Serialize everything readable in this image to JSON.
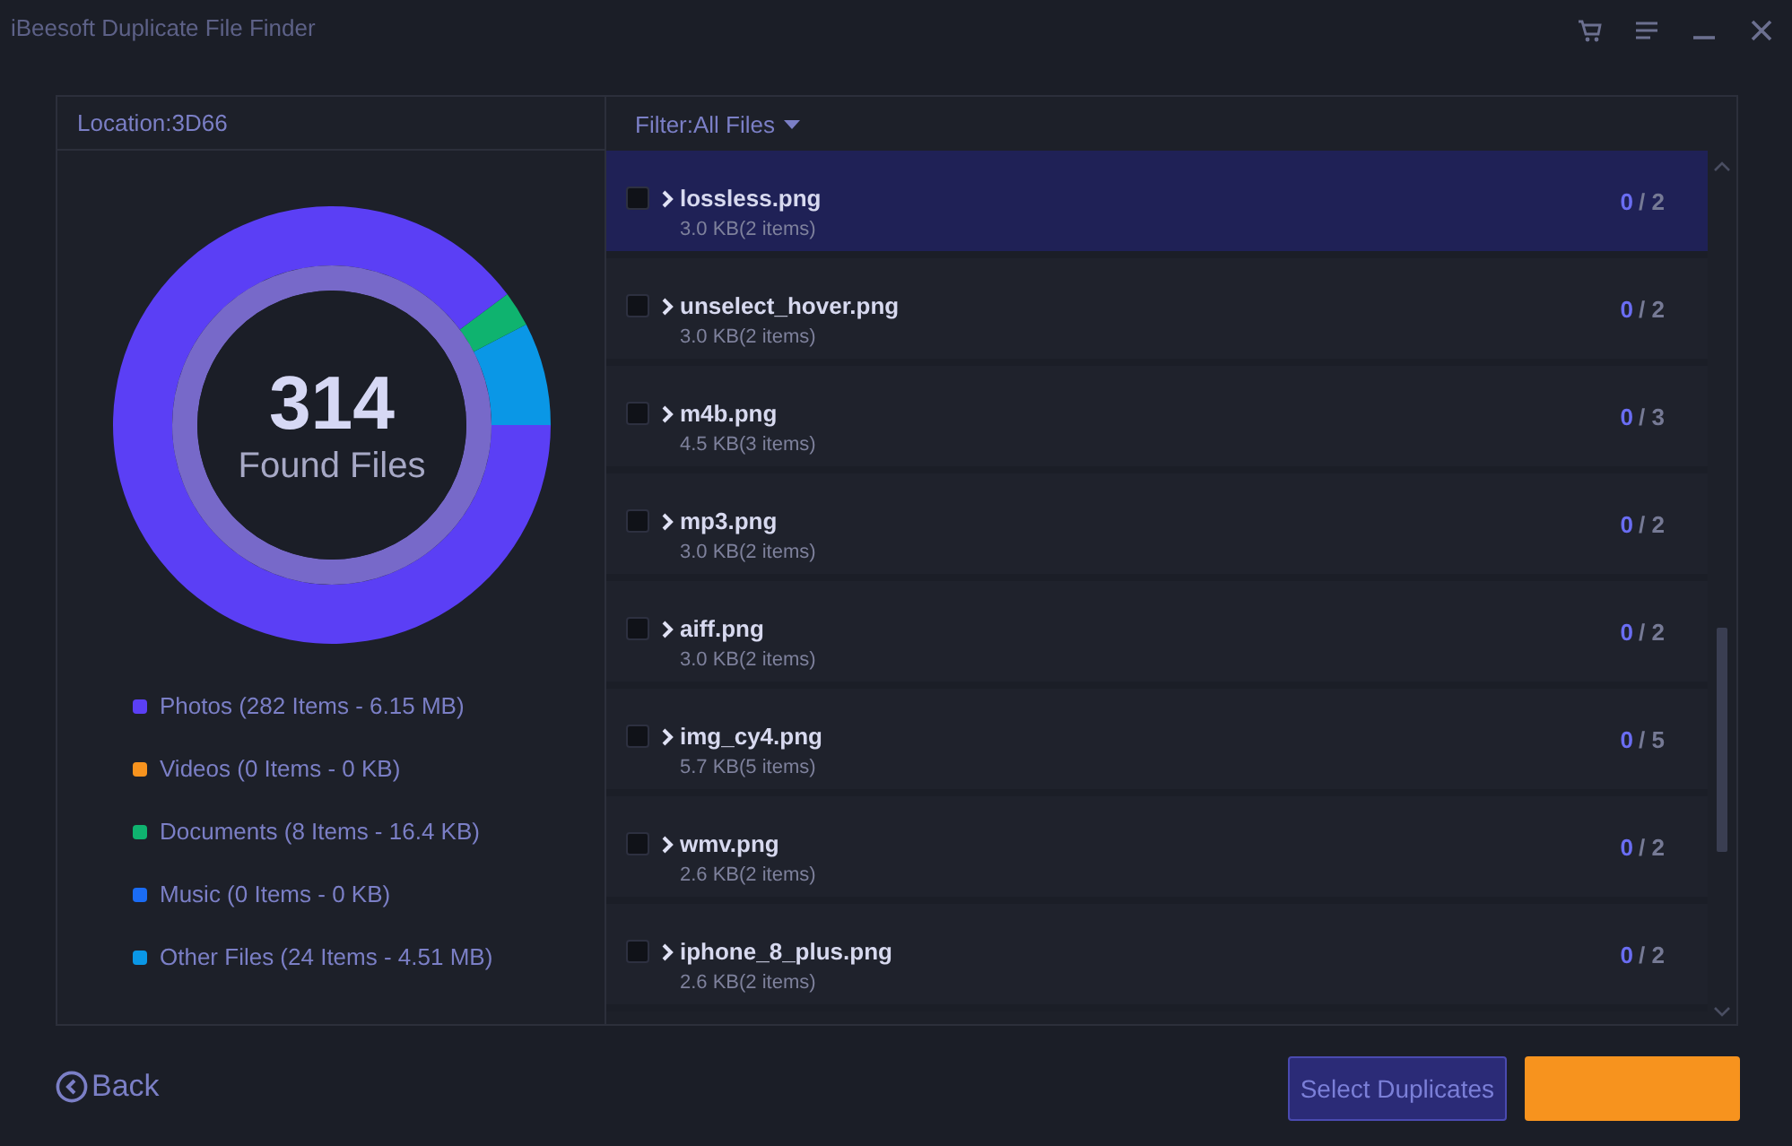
{
  "window": {
    "title": "iBeesoft Duplicate File Finder"
  },
  "location": {
    "label": "Location:3D66"
  },
  "summary": {
    "count": "314",
    "label": "Found Files",
    "chart_data": {
      "type": "donut",
      "values": [
        89.8,
        0,
        2.6,
        0,
        7.6
      ]
    }
  },
  "legend": [
    {
      "text": "Photos (282 Items - 6.15 MB)",
      "color": "#5b3ff5"
    },
    {
      "text": "Videos (0 Items - 0 KB)",
      "color": "#f7931e"
    },
    {
      "text": "Documents (8 Items - 16.4 KB)",
      "color": "#0fb36f"
    },
    {
      "text": "Music (0 Items - 0 KB)",
      "color": "#1a6cf5"
    },
    {
      "text": "Other Files (24 Items - 4.51 MB)",
      "color": "#0a97e6"
    }
  ],
  "filter": {
    "label": "Filter:All Files"
  },
  "files": [
    {
      "name": "lossless.png",
      "size": "3.0 KB(2 items)",
      "picked": "0",
      "of": "/ 2",
      "selected": true,
      "checked": false,
      "expanded": false
    },
    {
      "name": "unselect_hover.png",
      "size": "3.0 KB(2 items)",
      "picked": "0",
      "of": "/ 2",
      "selected": false,
      "checked": false,
      "expanded": false
    },
    {
      "name": "m4b.png",
      "size": "4.5 KB(3 items)",
      "picked": "0",
      "of": "/ 3",
      "selected": false,
      "checked": false,
      "expanded": false
    },
    {
      "name": "mp3.png",
      "size": "3.0 KB(2 items)",
      "picked": "0",
      "of": "/ 2",
      "selected": false,
      "checked": false,
      "expanded": false
    },
    {
      "name": "aiff.png",
      "size": "3.0 KB(2 items)",
      "picked": "0",
      "of": "/ 2",
      "selected": false,
      "checked": false,
      "expanded": false
    },
    {
      "name": "img_cy4.png",
      "size": "5.7 KB(5 items)",
      "picked": "0",
      "of": "/ 5",
      "selected": false,
      "checked": false,
      "expanded": false
    },
    {
      "name": "wmv.png",
      "size": "2.6 KB(2 items)",
      "picked": "0",
      "of": "/ 2",
      "selected": false,
      "checked": false,
      "expanded": false
    },
    {
      "name": "iphone_8_plus.png",
      "size": "2.6 KB(2 items)",
      "picked": "0",
      "of": "/ 2",
      "selected": false,
      "checked": false,
      "expanded": false
    }
  ],
  "back": {
    "label": "Back"
  },
  "buttons": [
    {
      "label": "Select Duplicates",
      "kind": "outline"
    },
    {
      "kind": "primary"
    }
  ]
}
